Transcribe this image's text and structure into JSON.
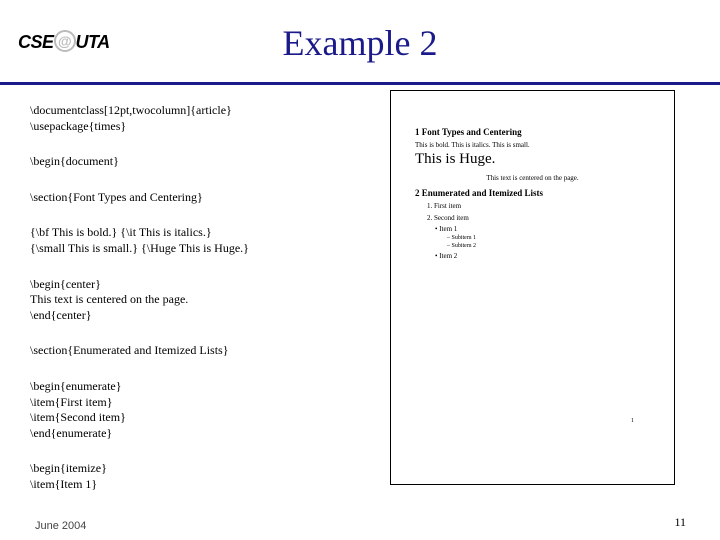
{
  "logo": {
    "left": "CSE",
    "right": "UTA"
  },
  "title": "Example 2",
  "code": {
    "b1a": "\\documentclass[12pt,twocolumn]{article}",
    "b1b": "\\usepackage{times}",
    "b2": "\\begin{document}",
    "b3": "\\section{Font Types and Centering}",
    "b4a": "{\\bf This is bold.} {\\it This is italics.}",
    "b4b": "{\\small This is small.} {\\Huge This is Huge.}",
    "b5a": "\\begin{center}",
    "b5b": "This text is centered on the page.",
    "b5c": "\\end{center}",
    "b6": "\\section{Enumerated and Itemized Lists}",
    "b7a": "\\begin{enumerate}",
    "b7b": "  \\item{First item}",
    "b7c": "  \\item{Second item}",
    "b7d": "\\end{enumerate}",
    "b8a": "\\begin{itemize}",
    "b8b": "  \\item{Item 1}"
  },
  "preview": {
    "sec1": "1   Font Types and Centering",
    "bold_line": "This is bold.  This is italics.  This is small.",
    "huge": "This is Huge.",
    "center": "This text is centered on the page.",
    "sec2": "2   Enumerated and Itemized Lists",
    "e1": "1. First item",
    "e2": "2. Second item",
    "i1": "• Item 1",
    "s1": "– Subitem 1",
    "s2": "– Subitem 2",
    "i2": "• Item 2",
    "col2": "1"
  },
  "footer": {
    "date": "June 2004",
    "page": "11"
  }
}
